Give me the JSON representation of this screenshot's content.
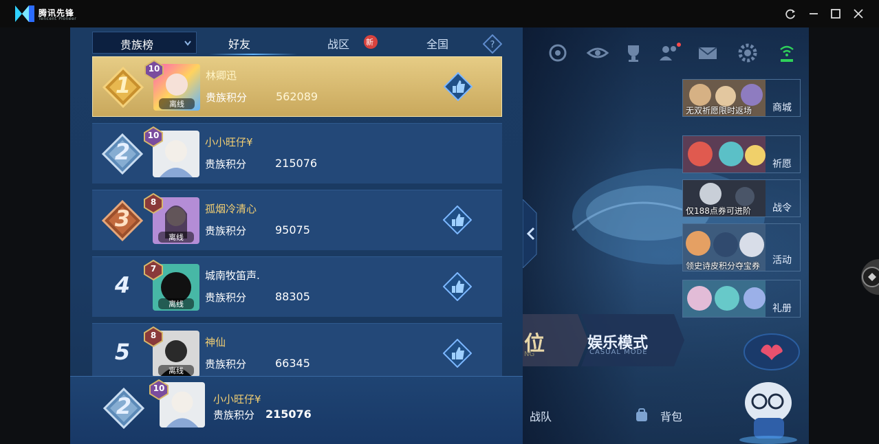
{
  "titlebar": {
    "app_name": "腾讯先锋",
    "app_subname": "Tencent Pioneer"
  },
  "panel": {
    "dropdown_label": "贵族榜",
    "tabs": [
      {
        "label": "好友",
        "active": true
      },
      {
        "label": "战区",
        "badge": "新"
      },
      {
        "label": "全国"
      }
    ],
    "score_label": "贵族积分",
    "offline_label": "离线",
    "rows": [
      {
        "rank": "1",
        "level": "10",
        "name": "林卿迅",
        "score": "562089",
        "offline": true,
        "liked": true
      },
      {
        "rank": "2",
        "level": "10",
        "name": "小小旺仔¥",
        "score": "215076",
        "offline": false,
        "liked": false
      },
      {
        "rank": "3",
        "level": "8",
        "name": "孤烟冷清心",
        "score": "95075",
        "offline": true,
        "liked": true
      },
      {
        "rank": "4",
        "level": "7",
        "name": "城南牧笛声.",
        "score": "88305",
        "offline": true,
        "liked": true
      },
      {
        "rank": "5",
        "level": "8",
        "name": "神仙",
        "score": "66345",
        "offline": true,
        "liked": true
      }
    ],
    "self": {
      "rank": "2",
      "level": "10",
      "name": "小小旺仔¥",
      "score": "215076"
    }
  },
  "game": {
    "cards": [
      {
        "caption": "无双祈愿限时返场",
        "side": "商城"
      },
      {
        "caption": "",
        "side": "祈愿"
      },
      {
        "caption": "仅188点券可进阶",
        "side": "战令"
      },
      {
        "caption": "领史诗皮积分夺宝券",
        "side": "活动"
      },
      {
        "caption": "",
        "side": "礼册"
      }
    ],
    "rank_fragment": "位",
    "rank_fragment_sub": "NG",
    "mode": "娱乐模式",
    "mode_sub": "CASUAL MODE",
    "bottom_nav": [
      "战队",
      "背包"
    ]
  },
  "colors": {
    "panel": "#1b3b63",
    "row": "#234878",
    "gold_row": "#d9bc70",
    "name_gold": "#f3cf72",
    "accent": "#63b6ff"
  }
}
